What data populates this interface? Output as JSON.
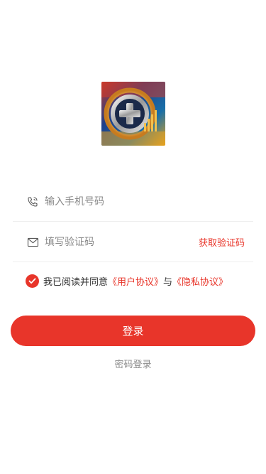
{
  "logo": {
    "icon": "app-logo-icon"
  },
  "form": {
    "phone": {
      "placeholder": "输入手机号码",
      "value": "",
      "icon": "phone-icon"
    },
    "code": {
      "placeholder": "填写验证码",
      "value": "",
      "icon": "mail-icon",
      "get_code_label": "获取验证码"
    }
  },
  "agreement": {
    "checked": true,
    "prefix": "我已阅读并同意",
    "user_agreement": "《用户协议》",
    "joiner": "与",
    "privacy_policy": "《隐私协议》"
  },
  "login_button": "登录",
  "password_login": "密码登录",
  "colors": {
    "accent": "#e8352a",
    "muted": "#8a8a8a"
  }
}
